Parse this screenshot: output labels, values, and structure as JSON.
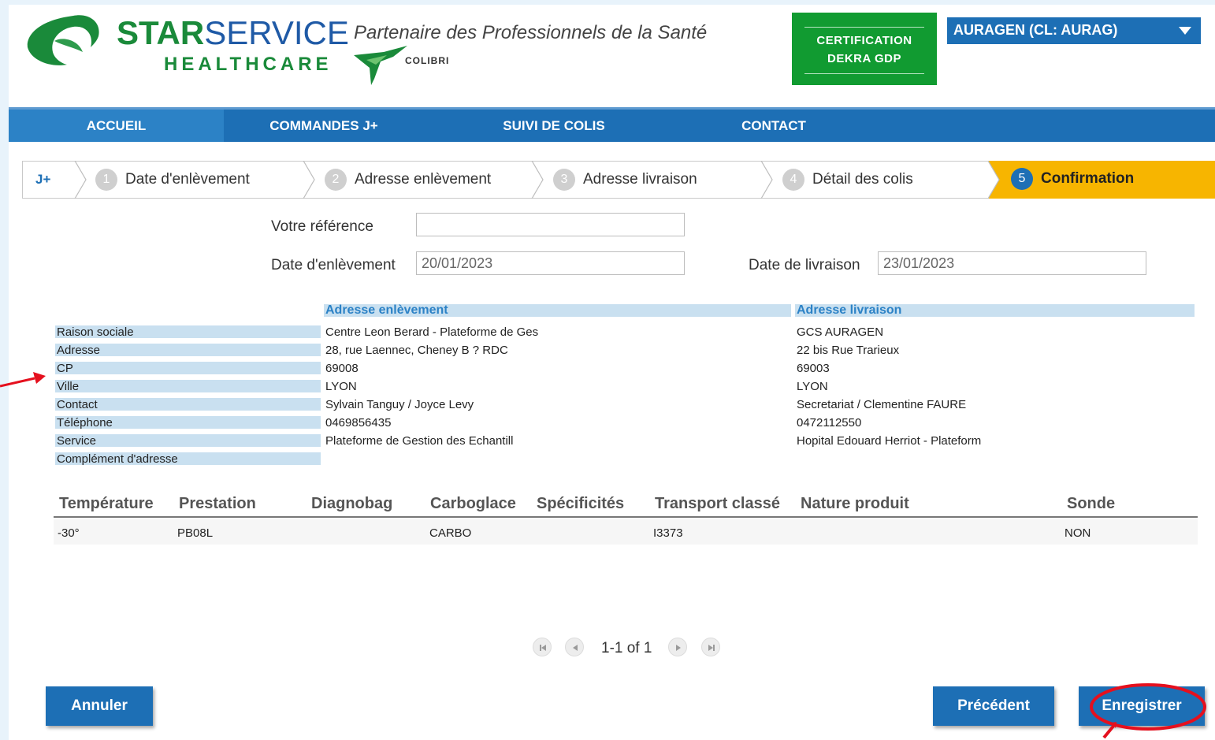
{
  "brand": {
    "star": "STAR",
    "service": "SERVICE",
    "healthcare": "HEALTHCARE",
    "tagline": "Partenaire des Professionnels de la Santé",
    "colibri": "COLIBRI",
    "logo_icon": "starservice-swoosh-logo",
    "bird_icon": "colibri-bird-logo"
  },
  "certification": {
    "line1": "CERTIFICATION",
    "line2": "DEKRA GDP",
    "color": "#119b31"
  },
  "account": {
    "selected": "AURAGEN (CL: AURAG)"
  },
  "nav": {
    "items": [
      {
        "label": "ACCUEIL",
        "active": true
      },
      {
        "label": "COMMANDES J+"
      },
      {
        "label": "SUIVI DE COLIS"
      },
      {
        "label": "CONTACT"
      }
    ]
  },
  "stepper": {
    "start": "J+",
    "steps": [
      {
        "num": "1",
        "label": "Date d'enlèvement"
      },
      {
        "num": "2",
        "label": "Adresse enlèvement"
      },
      {
        "num": "3",
        "label": "Adresse livraison"
      },
      {
        "num": "4",
        "label": "Détail des colis"
      },
      {
        "num": "5",
        "label": "Confirmation",
        "active": true
      }
    ]
  },
  "form": {
    "reference_label": "Votre référence",
    "reference_value": "",
    "pickup_date_label": "Date d'enlèvement",
    "pickup_date_value": "20/01/2023",
    "delivery_date_label": "Date de livraison",
    "delivery_date_value": "23/01/2023"
  },
  "addresses": {
    "pickup_header": "Adresse enlèvement",
    "delivery_header": "Adresse livraison",
    "rows": [
      {
        "label": "Raison sociale",
        "pickup": "Centre Leon Berard - Plateforme de Ges",
        "delivery": "GCS AURAGEN"
      },
      {
        "label": "Adresse",
        "pickup": "28, rue Laennec, Cheney B ? RDC",
        "delivery": "22 bis Rue Trarieux"
      },
      {
        "label": "CP",
        "pickup": "69008",
        "delivery": "69003"
      },
      {
        "label": "Ville",
        "pickup": "LYON",
        "delivery": "LYON"
      },
      {
        "label": "Contact",
        "pickup": "Sylvain Tanguy / Joyce Levy",
        "delivery": "Secretariat / Clementine FAURE"
      },
      {
        "label": "Téléphone",
        "pickup": "0469856435",
        "delivery": "0472112550"
      },
      {
        "label": "Service",
        "pickup": "Plateforme de Gestion des Echantill",
        "delivery": "Hopital Edouard Herriot - Plateform"
      },
      {
        "label": "Complément d'adresse",
        "pickup": "",
        "delivery": ""
      }
    ]
  },
  "table": {
    "headers": [
      "Température",
      "Prestation",
      "Diagnobag",
      "Carboglace",
      "Spécificités",
      "Transport classé",
      "Nature produit",
      "Sonde"
    ],
    "rows": [
      [
        "-30°",
        "PB08L",
        "",
        "CARBO",
        "",
        "I3373",
        "",
        "NON"
      ]
    ]
  },
  "pager": {
    "text": "1-1 of 1"
  },
  "buttons": {
    "cancel": "Annuler",
    "previous": "Précédent",
    "save": "Enregistrer"
  },
  "colors": {
    "primary": "#1d6fb5",
    "active_step": "#f7b500",
    "annotation": "#e5101e"
  }
}
